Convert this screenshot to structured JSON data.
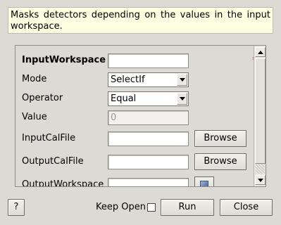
{
  "description": "Masks detectors depending on the values in the input workspace.",
  "fields": {
    "input_workspace": {
      "label": "InputWorkspace",
      "value": ""
    },
    "mode": {
      "label": "Mode",
      "value": "SelectIf"
    },
    "operator": {
      "label": "Operator",
      "value": "Equal"
    },
    "value": {
      "label": "Value",
      "placeholder": "0"
    },
    "input_cal_file": {
      "label": "InputCalFile",
      "value": "",
      "button": "Browse"
    },
    "output_cal_file": {
      "label": "OutputCalFile",
      "value": "",
      "button": "Browse"
    },
    "output_workspace": {
      "label": "OutputWorkspace",
      "value": ""
    }
  },
  "validation_marker": "*",
  "footer": {
    "help_label": "?",
    "keep_open_label": "Keep Open",
    "run_label": "Run",
    "close_label": "Close"
  },
  "icons": {
    "combo_arrow": "chevron-down-icon",
    "scroll_up": "arrow-up-icon",
    "scroll_down": "arrow-down-icon",
    "workspace_picker": "workspace-icon"
  }
}
